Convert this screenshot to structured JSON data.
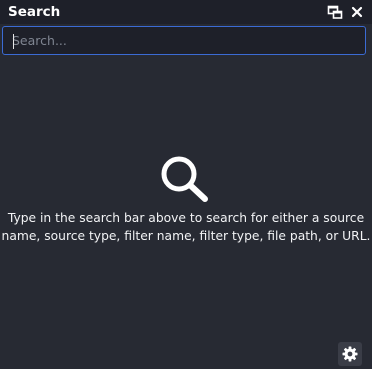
{
  "panel": {
    "title": "Search",
    "undock_icon": "undock-icon",
    "close_icon": "close-icon"
  },
  "search": {
    "placeholder": "Search...",
    "value": ""
  },
  "empty_state": {
    "icon": "search-icon",
    "hint": "Type in the search bar above to search for either a source name, source type, filter name, filter type, file path, or URL."
  },
  "footer": {
    "settings_icon": "gear-icon"
  },
  "colors": {
    "background": "#272a33",
    "titlebar": "#1e2029",
    "accent": "#3b6bd4",
    "text": "#ffffff"
  }
}
